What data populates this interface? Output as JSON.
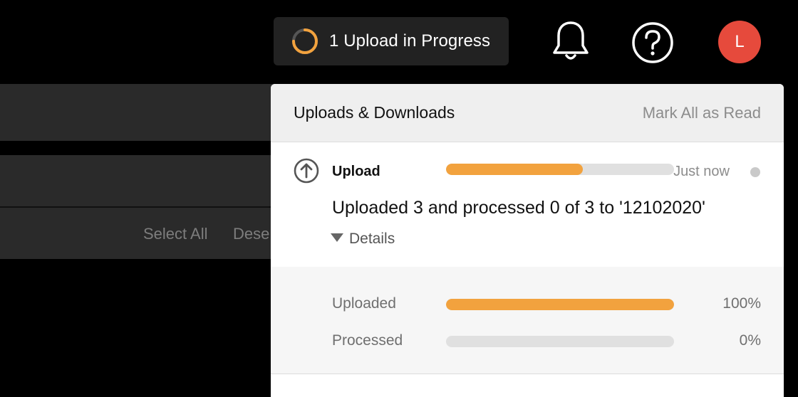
{
  "topbar": {
    "upload_status_label": "1 Upload in Progress",
    "upload_spinner_progress": 0.75,
    "avatar_initial": "L",
    "accent_color": "#f2a23e",
    "avatar_color": "#e64a3c"
  },
  "background": {
    "select_all_label": "Select All",
    "deselect_label": "Dese"
  },
  "panel": {
    "title": "Uploads & Downloads",
    "mark_all_label": "Mark All as Read",
    "item": {
      "type_label": "Upload",
      "progress": 0.6,
      "time": "Just now",
      "message": "Uploaded 3 and processed 0 of 3 to '12102020'",
      "details_label": "Details",
      "details": [
        {
          "label": "Uploaded",
          "progress": 1.0,
          "percent": "100%"
        },
        {
          "label": "Processed",
          "progress": 0.0,
          "percent": "0%"
        }
      ]
    }
  }
}
